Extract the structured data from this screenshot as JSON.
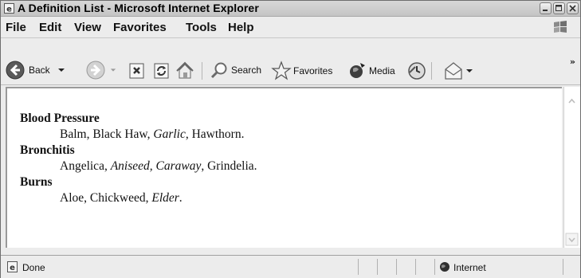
{
  "window": {
    "title": "A Definition List - Microsoft Internet Explorer"
  },
  "menu": {
    "items": [
      "File",
      "Edit",
      "View",
      "Favorites",
      "Tools",
      "Help"
    ]
  },
  "toolbar": {
    "back_label": "Back",
    "search_label": "Search",
    "favorites_label": "Favorites",
    "media_label": "Media",
    "more_symbol": "»"
  },
  "content": {
    "entries": [
      {
        "term": "Blood Pressure",
        "definition": [
          {
            "text": "Balm, Black Haw, ",
            "italic": false
          },
          {
            "text": "Garlic",
            "italic": true
          },
          {
            "text": ", Hawthorn.",
            "italic": false
          }
        ]
      },
      {
        "term": "Bronchitis",
        "definition": [
          {
            "text": "Angelica, ",
            "italic": false
          },
          {
            "text": "Aniseed, Caraway",
            "italic": true
          },
          {
            "text": ", Grindelia.",
            "italic": false
          }
        ]
      },
      {
        "term": "Burns",
        "definition": [
          {
            "text": "Aloe, Chickweed, ",
            "italic": false
          },
          {
            "text": "Elder",
            "italic": true
          },
          {
            "text": ".",
            "italic": false
          }
        ]
      }
    ]
  },
  "status": {
    "text": "Done",
    "zone": "Internet"
  }
}
